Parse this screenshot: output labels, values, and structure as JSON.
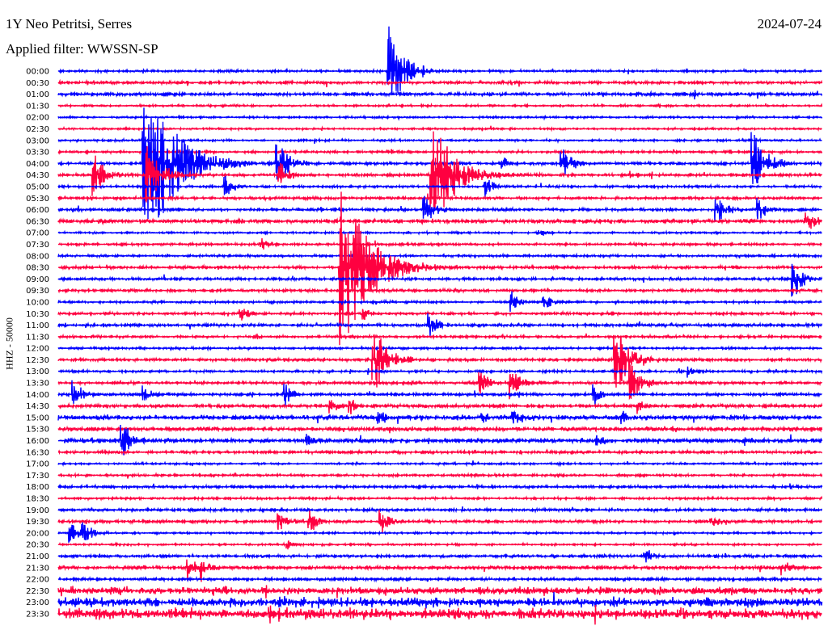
{
  "header": {
    "station": "1Y Neo Petritsi, Serres",
    "filter": "Applied filter: WWSSN-SP",
    "date": "2024-07-24"
  },
  "chart_data": {
    "type": "line",
    "title": "1Y Neo Petritsi, Serres",
    "subtitle": "Applied filter: WWSSN-SP",
    "ylabel": "HHZ - 50000",
    "xlabel": "",
    "x_range_minutes": [
      0,
      30
    ],
    "row_labels": [
      "00:00",
      "00:30",
      "01:00",
      "01:30",
      "02:00",
      "02:30",
      "03:00",
      "03:30",
      "04:00",
      "04:30",
      "05:00",
      "05:30",
      "06:00",
      "06:30",
      "07:00",
      "07:30",
      "08:00",
      "08:30",
      "09:00",
      "09:30",
      "10:00",
      "10:30",
      "11:00",
      "11:30",
      "12:00",
      "12:30",
      "13:00",
      "13:30",
      "14:00",
      "14:30",
      "15:00",
      "15:30",
      "16:00",
      "16:30",
      "17:00",
      "17:30",
      "18:00",
      "18:30",
      "19:00",
      "19:30",
      "20:00",
      "20:30",
      "21:00",
      "21:30",
      "22:00",
      "22:30",
      "23:00",
      "23:30"
    ],
    "series_colors": [
      "#0000ff",
      "#ff0040"
    ],
    "noise_level": [
      1.2,
      1.5,
      1.8,
      1,
      1,
      1,
      1,
      1.2,
      1.5,
      1.5,
      1.2,
      1.5,
      1.5,
      2.2,
      1,
      1.2,
      1.2,
      1.5,
      1.5,
      1.5,
      1.2,
      1.3,
      1.5,
      1.3,
      1.2,
      1.5,
      1.2,
      1.5,
      1.5,
      1.8,
      2.5,
      2.2,
      2.5,
      1.5,
      1,
      1.2,
      1.5,
      1.2,
      1.5,
      1.5,
      1,
      1,
      1.5,
      2,
      1.5,
      4,
      5,
      5.5
    ],
    "events": [
      {
        "row": 0,
        "minute": 13.0,
        "amp": 55
      },
      {
        "row": 8,
        "minute": 3.4,
        "amp": 120
      },
      {
        "row": 9,
        "minute": 1.4,
        "amp": 28
      },
      {
        "row": 9,
        "minute": 3.5,
        "amp": 40
      },
      {
        "row": 8,
        "minute": 8.6,
        "amp": 32
      },
      {
        "row": 9,
        "minute": 8.7,
        "amp": 18
      },
      {
        "row": 9,
        "minute": 14.7,
        "amp": 80
      },
      {
        "row": 8,
        "minute": 17.5,
        "amp": 8
      },
      {
        "row": 8,
        "minute": 19.8,
        "amp": 20
      },
      {
        "row": 8,
        "minute": 27.3,
        "amp": 42
      },
      {
        "row": 10,
        "minute": 6.6,
        "amp": 14
      },
      {
        "row": 10,
        "minute": 16.8,
        "amp": 15
      },
      {
        "row": 12,
        "minute": 14.4,
        "amp": 22
      },
      {
        "row": 12,
        "minute": 25.9,
        "amp": 20
      },
      {
        "row": 12,
        "minute": 27.5,
        "amp": 15
      },
      {
        "row": 13,
        "minute": 29.4,
        "amp": 16
      },
      {
        "row": 14,
        "minute": 18.9,
        "amp": 9
      },
      {
        "row": 15,
        "minute": 8.0,
        "amp": 9
      },
      {
        "row": 17,
        "minute": 11.1,
        "amp": 110
      },
      {
        "row": 18,
        "minute": 28.9,
        "amp": 25
      },
      {
        "row": 20,
        "minute": 17.8,
        "amp": 15
      },
      {
        "row": 20,
        "minute": 19.1,
        "amp": 14
      },
      {
        "row": 21,
        "minute": 7.2,
        "amp": 12
      },
      {
        "row": 21,
        "minute": 12.0,
        "amp": 9
      },
      {
        "row": 22,
        "minute": 14.6,
        "amp": 16
      },
      {
        "row": 25,
        "minute": 12.4,
        "amp": 45
      },
      {
        "row": 25,
        "minute": 21.9,
        "amp": 45
      },
      {
        "row": 26,
        "minute": 24.8,
        "amp": 8
      },
      {
        "row": 27,
        "minute": 16.6,
        "amp": 16
      },
      {
        "row": 27,
        "minute": 17.8,
        "amp": 20
      },
      {
        "row": 27,
        "minute": 22.5,
        "amp": 28
      },
      {
        "row": 28,
        "minute": 0.6,
        "amp": 18
      },
      {
        "row": 28,
        "minute": 3.4,
        "amp": 12
      },
      {
        "row": 28,
        "minute": 8.9,
        "amp": 15
      },
      {
        "row": 28,
        "minute": 21.1,
        "amp": 14
      },
      {
        "row": 29,
        "minute": 10.7,
        "amp": 12
      },
      {
        "row": 29,
        "minute": 11.5,
        "amp": 10
      },
      {
        "row": 29,
        "minute": 22.8,
        "amp": 12
      },
      {
        "row": 30,
        "minute": 12.6,
        "amp": 12
      },
      {
        "row": 30,
        "minute": 16.7,
        "amp": 10
      },
      {
        "row": 30,
        "minute": 17.9,
        "amp": 12
      },
      {
        "row": 30,
        "minute": 22.2,
        "amp": 10
      },
      {
        "row": 32,
        "minute": 2.5,
        "amp": 26
      },
      {
        "row": 32,
        "minute": 9.8,
        "amp": 8
      },
      {
        "row": 32,
        "minute": 21.2,
        "amp": 8
      },
      {
        "row": 33,
        "minute": 1.8,
        "amp": 6
      },
      {
        "row": 39,
        "minute": 8.7,
        "amp": 14
      },
      {
        "row": 39,
        "minute": 9.9,
        "amp": 15
      },
      {
        "row": 39,
        "minute": 12.7,
        "amp": 18
      },
      {
        "row": 39,
        "minute": 25.7,
        "amp": 10
      },
      {
        "row": 40,
        "minute": 0.5,
        "amp": 15
      },
      {
        "row": 40,
        "minute": 1.0,
        "amp": 16
      },
      {
        "row": 41,
        "minute": 9.0,
        "amp": 6
      },
      {
        "row": 42,
        "minute": 23.1,
        "amp": 10
      },
      {
        "row": 43,
        "minute": 5.1,
        "amp": 16
      },
      {
        "row": 43,
        "minute": 5.6,
        "amp": 15
      },
      {
        "row": 43,
        "minute": 28.5,
        "amp": 12
      }
    ]
  }
}
